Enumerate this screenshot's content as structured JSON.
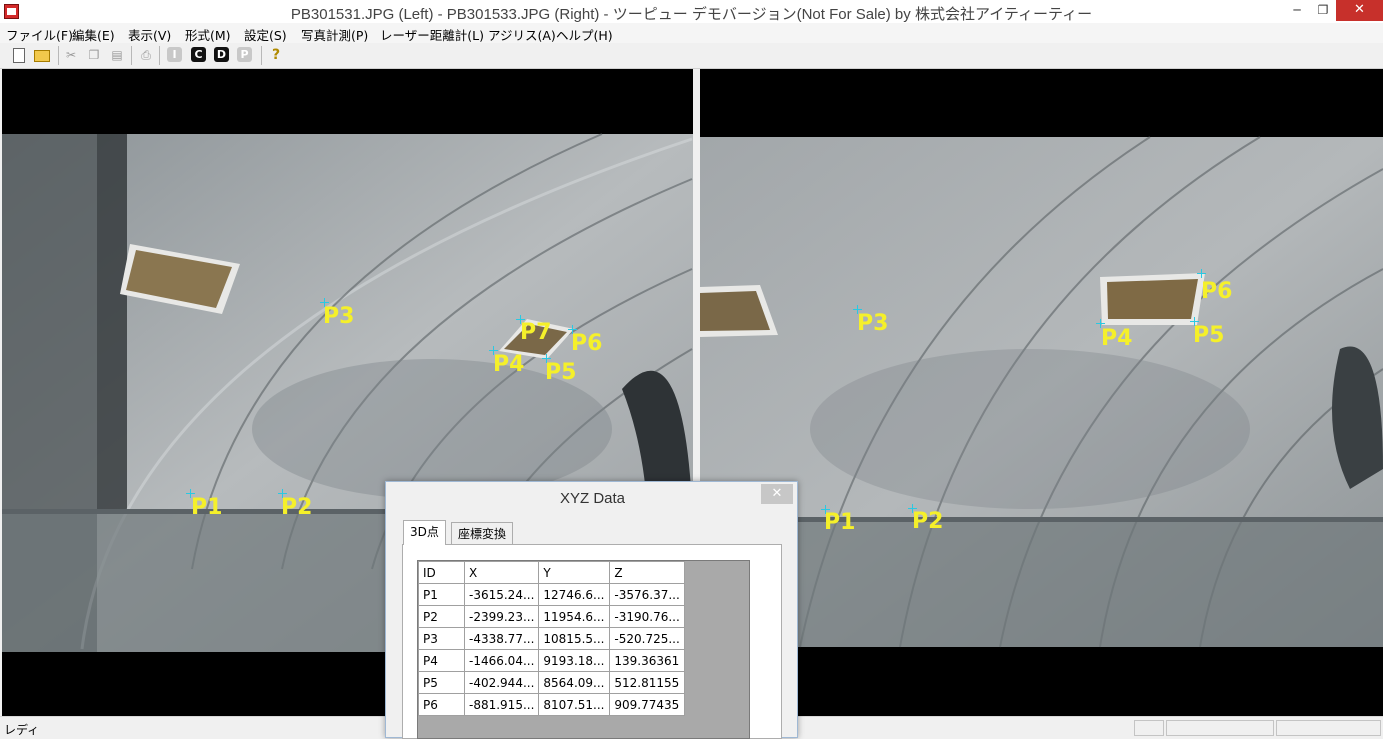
{
  "window": {
    "title": "PB301531.JPG (Left) - PB301533.JPG (Right) - ツーピュー デモバージョン(Not For Sale) by 株式会社アイティーティー",
    "minimize": "─",
    "restore": "❐",
    "close": "✕"
  },
  "menu": [
    "ファイル(F)",
    "編集(E)",
    "表示(V)",
    "形式(M)",
    "設定(S)",
    "写真計測(P)",
    "レーザー距離計(L)",
    "アジリス(A)",
    "ヘルプ(H)"
  ],
  "toolbar": {
    "icons": [
      "new-file-icon",
      "open-folder-icon",
      "cut-icon",
      "copy-icon",
      "paste-icon",
      "print-icon",
      "i-mode-icon",
      "c-mode-icon",
      "d-mode-icon",
      "p-mode-icon",
      "help-icon"
    ],
    "letters": {
      "i": "I",
      "c": "C",
      "d": "D",
      "p": "P"
    },
    "help": "?"
  },
  "left_pane": {
    "points": [
      {
        "label": "P1"
      },
      {
        "label": "P2"
      },
      {
        "label": "P3"
      },
      {
        "label": "P7"
      },
      {
        "label": "P6"
      },
      {
        "label": "P4"
      },
      {
        "label": "P5"
      }
    ]
  },
  "right_pane": {
    "points": [
      {
        "label": "P6"
      },
      {
        "label": "P3"
      },
      {
        "label": "P4"
      },
      {
        "label": "P5"
      },
      {
        "label": "P1"
      },
      {
        "label": "P2"
      }
    ]
  },
  "dialog": {
    "title": "XYZ Data",
    "close": "✕",
    "tabs": [
      "3D点",
      "座標変換"
    ],
    "columns": [
      "ID",
      "X",
      "Y",
      "Z"
    ],
    "rows": [
      [
        "P1",
        "-3615.24...",
        "12746.6...",
        "-3576.37..."
      ],
      [
        "P2",
        "-2399.23...",
        "11954.6...",
        "-3190.76..."
      ],
      [
        "P3",
        "-4338.77...",
        "10815.5...",
        "-520.725..."
      ],
      [
        "P4",
        "-1466.04...",
        "9193.18...",
        "139.36361"
      ],
      [
        "P5",
        "-402.944...",
        "8564.09...",
        "512.81155"
      ],
      [
        "P6",
        "-881.915...",
        "8107.51...",
        "909.77435"
      ]
    ]
  },
  "status": {
    "text": "レディ"
  }
}
